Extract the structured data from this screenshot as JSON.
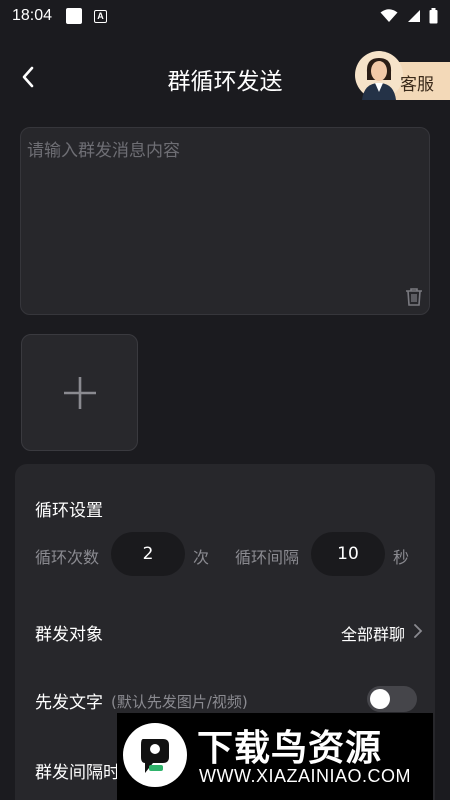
{
  "status_bar": {
    "time": "18:04",
    "notif_icon": "A"
  },
  "header": {
    "title": "群循环发送",
    "service_label": "客服"
  },
  "message": {
    "placeholder": "请输入群发消息内容",
    "value": ""
  },
  "loop_settings": {
    "title": "循环设置",
    "count_label": "循环次数",
    "count_value": "2",
    "count_unit": "次",
    "interval_label": "循环间隔",
    "interval_value": "10",
    "interval_unit": "秒"
  },
  "target": {
    "label": "群发对象",
    "value": "全部群聊"
  },
  "text_first": {
    "label": "先发文字",
    "hint": "(默认先发图片/视频)",
    "enabled": false
  },
  "group_interval": {
    "label": "群发间隔时"
  },
  "watermark": {
    "brand": "下载鸟资源",
    "url": "WWW.XIAZAINIAO.COM"
  },
  "icons": {
    "back": "chevron-left-icon",
    "trash": "trash-icon",
    "add": "plus-icon",
    "chevron": "chevron-right-icon",
    "wifi": "wifi-icon",
    "signal": "signal-icon",
    "battery": "battery-icon"
  },
  "colors": {
    "background": "#1b1b1f",
    "card": "#27272b",
    "service_bg": "#f3d9b8",
    "muted_text": "#8a8a90"
  }
}
